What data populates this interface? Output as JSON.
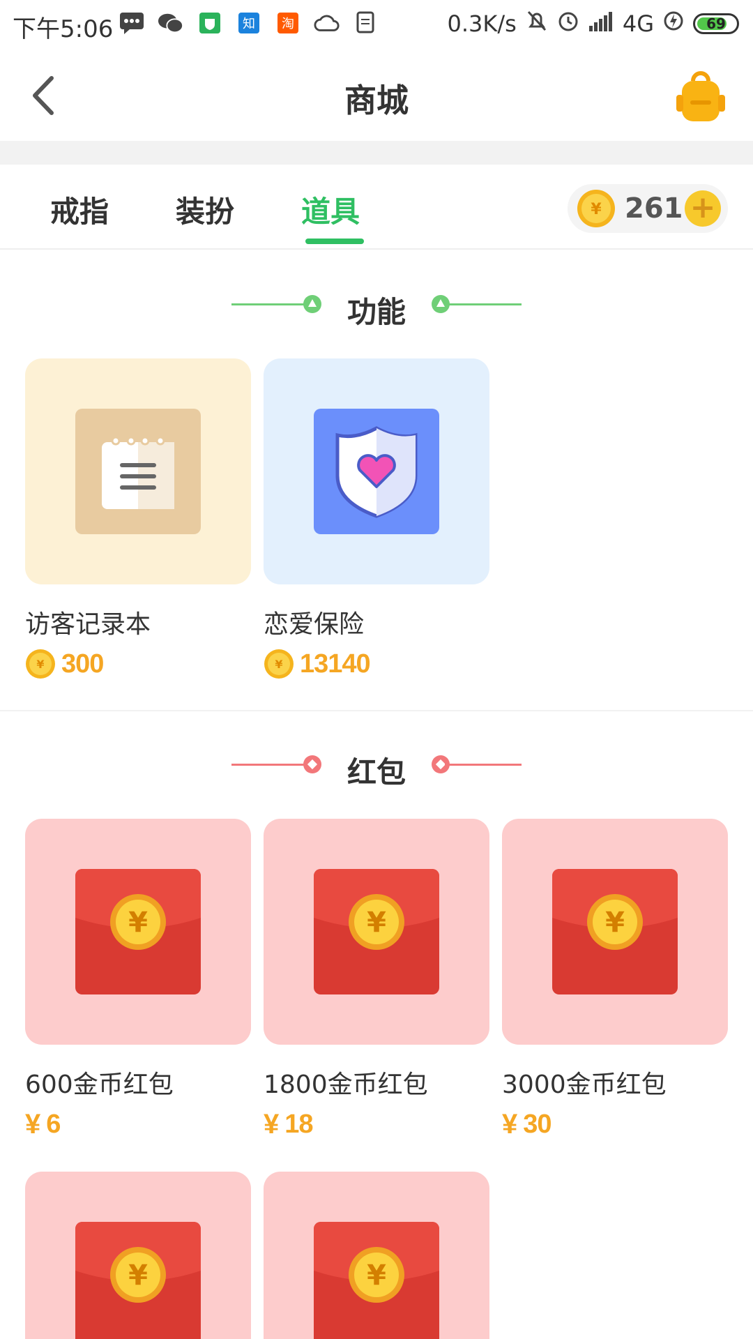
{
  "status_bar": {
    "time": "下午5:06",
    "net_speed": "0.3K/s",
    "network": "4G",
    "battery": "69",
    "icons": [
      "message-icon",
      "wechat-icon",
      "shield-app-icon",
      "zhihu-icon",
      "taobao-icon",
      "cloud-icon",
      "document-icon",
      "mute-icon",
      "alarm-icon",
      "signal-icon",
      "charging-icon",
      "battery-icon"
    ]
  },
  "header": {
    "title": "商城",
    "back_icon": "chevron-left-icon",
    "bag_icon": "backpack-icon"
  },
  "tabs": [
    {
      "label": "戒指",
      "active": false
    },
    {
      "label": "装扮",
      "active": false
    },
    {
      "label": "道具",
      "active": true
    }
  ],
  "balance": {
    "count": "261",
    "plus": "+"
  },
  "sections": {
    "function": {
      "title": "功能",
      "accent": "#6fcf77",
      "items": [
        {
          "name": "访客记录本",
          "price": "300",
          "icon": "notebook-icon",
          "tile_bg": "#fdf1d5",
          "icon_bg": "#e8cba0"
        },
        {
          "name": "恋爱保险",
          "price": "13140",
          "icon": "shield-heart-icon",
          "tile_bg": "#e3f0fd",
          "icon_bg": "#6b8ffb"
        }
      ]
    },
    "redpacket": {
      "title": "红包",
      "accent": "#f2777a",
      "items": [
        {
          "name": "600金币红包",
          "price": "6",
          "currency": "¥"
        },
        {
          "name": "1800金币红包",
          "price": "18",
          "currency": "¥"
        },
        {
          "name": "3000金币红包",
          "price": "30",
          "currency": "¥"
        }
      ]
    }
  },
  "colors": {
    "active_tab": "#2fbf62",
    "price": "#f5a623",
    "redpacket_tile": "#fdcccc",
    "redpacket_body": "#e14a40",
    "coin": "#f7c92c"
  }
}
